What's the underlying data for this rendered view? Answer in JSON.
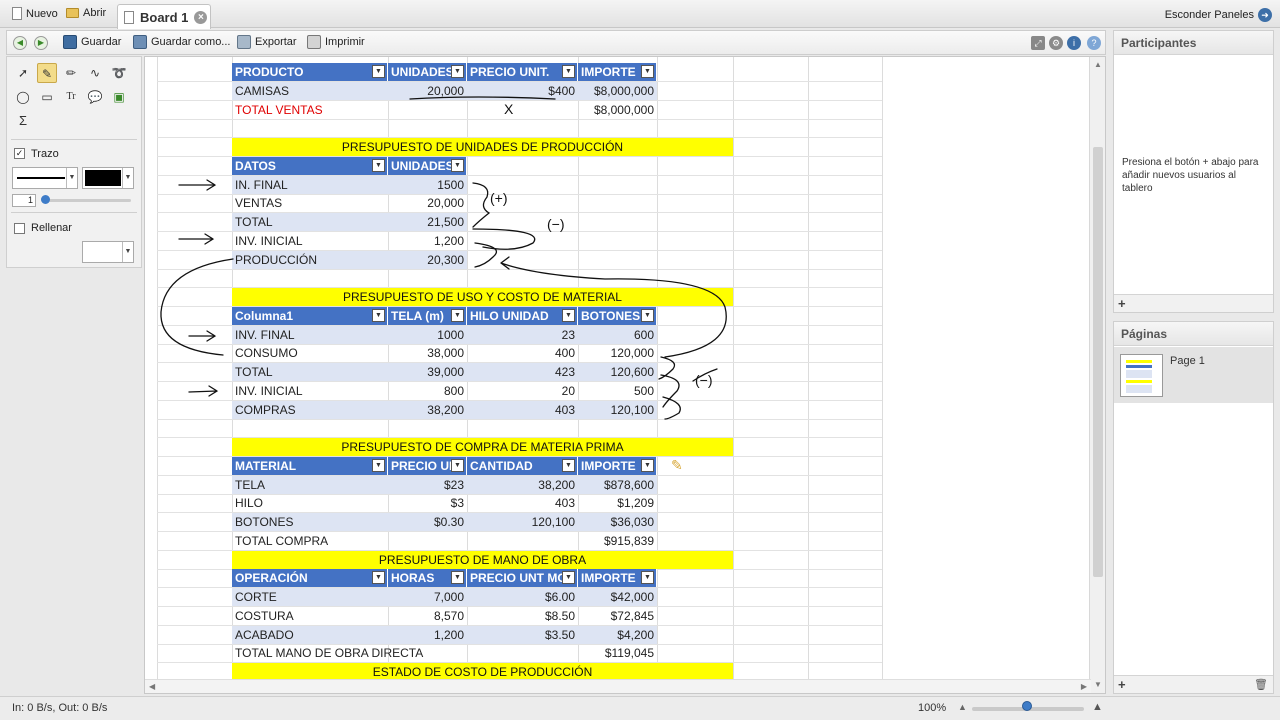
{
  "tabbar": {
    "new_label": "Nuevo",
    "open_label": "Abrir",
    "active_tab": "Board 1",
    "hide_panels": "Esconder Paneles"
  },
  "toolbar": {
    "save": "Guardar",
    "save_as": "Guardar como...",
    "export": "Exportar",
    "print": "Imprimir"
  },
  "tools": {
    "trazo": "Trazo",
    "stroke_width": "1",
    "rellenar": "Rellenar",
    "text_tool": "Tr",
    "sum_tool": "Σ",
    "stroke_color": "#000000"
  },
  "sheet": {
    "t1": {
      "headers": [
        "PRODUCTO",
        "UNIDADES",
        "PRECIO UNIT.",
        "IMPORTE"
      ],
      "rows": [
        [
          "CAMISAS",
          "20,000",
          "$400",
          "$8,000,000"
        ]
      ],
      "total": [
        "TOTAL VENTAS",
        "$8,000,000"
      ]
    },
    "t2": {
      "title": "PRESUPUESTO DE UNIDADES DE PRODUCCIÓN",
      "headers": [
        "DATOS",
        "UNIDADES"
      ],
      "rows": [
        [
          "IN. FINAL",
          "1500"
        ],
        [
          "VENTAS",
          "20,000"
        ],
        [
          "TOTAL",
          "21,500"
        ],
        [
          "INV. INICIAL",
          "1,200"
        ],
        [
          "PRODUCCIÓN",
          "20,300"
        ]
      ]
    },
    "t3": {
      "title": "PRESUPUESTO DE USO Y COSTO DE MATERIAL",
      "headers": [
        "Columna1",
        "TELA (m)",
        "HILO UNIDAD",
        "BOTONES"
      ],
      "rows": [
        [
          "INV. FINAL",
          "1000",
          "23",
          "600"
        ],
        [
          "CONSUMO",
          "38,000",
          "400",
          "120,000"
        ],
        [
          "TOTAL",
          "39,000",
          "423",
          "120,600"
        ],
        [
          "INV. INICIAL",
          "800",
          "20",
          "500"
        ],
        [
          "COMPRAS",
          "38,200",
          "403",
          "120,100"
        ]
      ]
    },
    "t4": {
      "title": "PRESUPUESTO DE COMPRA DE MATERIA PRIMA",
      "headers": [
        "MATERIAL",
        "PRECIO UN",
        "CANTIDAD",
        "IMPORTE"
      ],
      "rows": [
        [
          "TELA",
          "$23",
          "38,200",
          "$878,600"
        ],
        [
          "HILO",
          "$3",
          "403",
          "$1,209"
        ],
        [
          "BOTONES",
          "$0.30",
          "120,100",
          "$36,030"
        ]
      ],
      "total": [
        "TOTAL COMPRA",
        "$915,839"
      ]
    },
    "t5": {
      "title": "PRESUPUESTO DE MANO DE OBRA",
      "headers": [
        "OPERACIÓN",
        "HORAS",
        "PRECIO UNT MO",
        "IMPORTE"
      ],
      "rows": [
        [
          "CORTE",
          "7,000",
          "$6.00",
          "$42,000"
        ],
        [
          "COSTURA",
          "8,570",
          "$8.50",
          "$72,845"
        ],
        [
          "ACABADO",
          "1,200",
          "$3.50",
          "$4,200"
        ]
      ],
      "total": [
        "TOTAL MANO DE OBRA DIRECTA",
        "$119,045"
      ]
    },
    "t6": {
      "title": "ESTADO DE COSTO DE PRODUCCIÓN"
    },
    "annotations": {
      "x_mark": "X",
      "plus_mark": "(+)",
      "minus_mark_1": "(−)",
      "minus_mark_2": "(−)"
    }
  },
  "participants": {
    "title": "Participantes",
    "message": "Presiona el botón + abajo para añadir nuevos usuarios al tablero"
  },
  "pages": {
    "title": "Páginas",
    "items": [
      "Page 1"
    ]
  },
  "status": {
    "traffic": "In: 0 B/s, Out: 0 B/s",
    "zoom": "100%"
  },
  "colors": {
    "header_blue": "#4472c4",
    "title_yellow": "#ffff00",
    "band": "#dde4f3",
    "total_red": "#e00000"
  }
}
